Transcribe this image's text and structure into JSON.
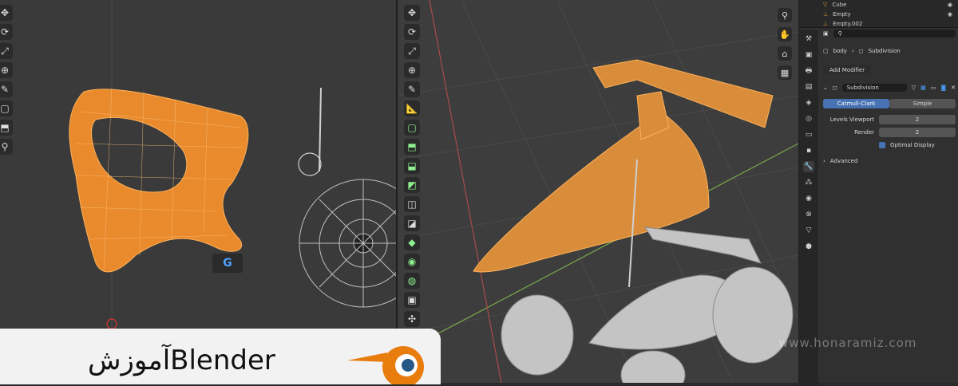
{
  "outliner": {
    "items": [
      {
        "label": "Cube",
        "type": "mesh"
      },
      {
        "label": "Empty",
        "type": "empty"
      },
      {
        "label": "Empty.002",
        "type": "empty"
      }
    ],
    "search_placeholder": ""
  },
  "properties": {
    "breadcrumb_object": "body",
    "breadcrumb_modifier": "Subdivision",
    "add_modifier_label": "Add Modifier",
    "modifier_name": "Subdivision",
    "catmull_clark_label": "Catmull-Clark",
    "simple_label": "Simple",
    "levels_viewport_label": "Levels Viewport",
    "levels_viewport_value": "2",
    "render_label": "Render",
    "render_value": "2",
    "optimal_display_label": "Optimal Display",
    "advanced_label": "Advanced"
  },
  "banner": {
    "title": "آموزشBlender"
  },
  "watermark": "www.honaramiz.com",
  "badge": "G",
  "colors": {
    "accent": "#4772b3",
    "selected_mesh": "#f08c2a",
    "background": "#3a3a3a"
  }
}
